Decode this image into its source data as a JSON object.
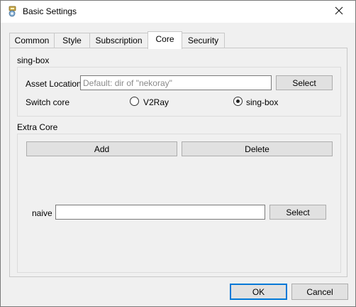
{
  "window": {
    "title": "Basic Settings"
  },
  "tabs": [
    {
      "label": "Common"
    },
    {
      "label": "Style"
    },
    {
      "label": "Subscription"
    },
    {
      "label": "Core"
    },
    {
      "label": "Security"
    }
  ],
  "active_tab": "Core",
  "singbox_group": {
    "title": "sing-box",
    "asset_location_label": "Asset Location",
    "asset_location_value": "",
    "asset_location_placeholder": "Default: dir of \"nekoray\"",
    "asset_select_label": "Select",
    "switch_core_label": "Switch core",
    "options": [
      {
        "label": "V2Ray",
        "checked": false
      },
      {
        "label": "sing-box",
        "checked": true
      }
    ]
  },
  "extra_core_group": {
    "title": "Extra Core",
    "add_label": "Add",
    "delete_label": "Delete",
    "rows": [
      {
        "name": "naive",
        "path": "",
        "select_label": "Select"
      }
    ]
  },
  "footer": {
    "ok_label": "OK",
    "cancel_label": "Cancel"
  },
  "icons": {
    "app": "settings-gear-app-icon",
    "close": "close-icon"
  }
}
